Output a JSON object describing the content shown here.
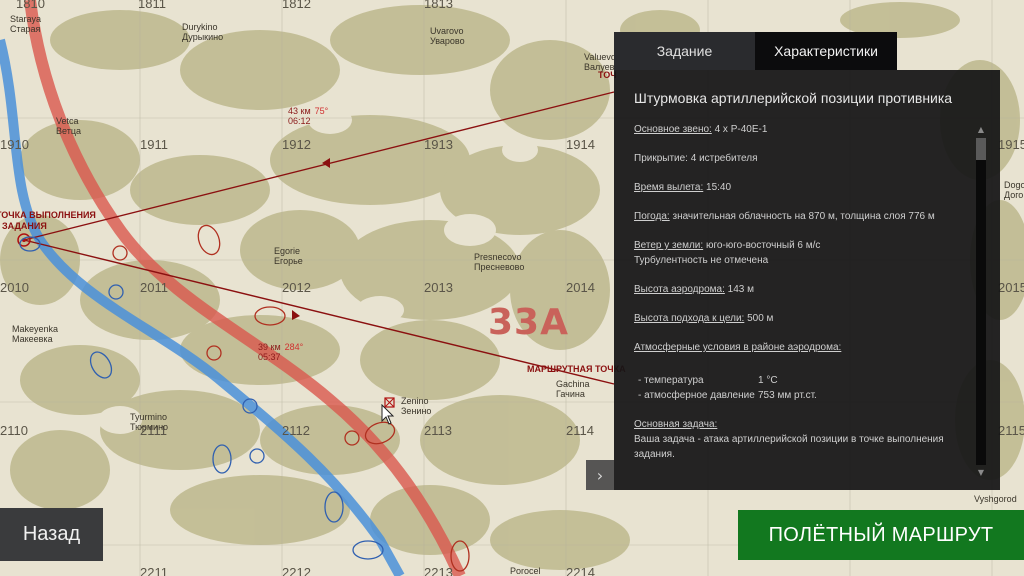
{
  "map": {
    "grid_numbers": [
      "1810",
      "1811",
      "1812",
      "1813",
      "1910",
      "1911",
      "1912",
      "1913",
      "1914",
      "2010",
      "2011",
      "2012",
      "2013",
      "2014",
      "2110",
      "2111",
      "2112",
      "2113",
      "2114",
      "2211",
      "2212",
      "2213",
      "2214",
      "1915",
      "2015",
      "2115"
    ],
    "places": [
      {
        "name_lat": "Staraya",
        "name_cyr": "Старая"
      },
      {
        "name_lat": "Durykino",
        "name_cyr": "Дурыкино"
      },
      {
        "name_lat": "Uvarovo",
        "name_cyr": "Уварово"
      },
      {
        "name_lat": "Valuevo",
        "name_cyr": "Валуево"
      },
      {
        "name_lat": "Vetca",
        "name_cyr": "Ветца"
      },
      {
        "name_lat": "Egorie",
        "name_cyr": "Егорье"
      },
      {
        "name_lat": "Presnecovo",
        "name_cyr": "Пресневово"
      },
      {
        "name_lat": "Makeyenka",
        "name_cyr": "Макеевка"
      },
      {
        "name_lat": "Zenino",
        "name_cyr": "Зенино"
      },
      {
        "name_lat": "Tyurmino",
        "name_cyr": "Тюрмино"
      },
      {
        "name_lat": "Gachina",
        "name_cyr": "Гачина"
      },
      {
        "name_lat": "Dogo",
        "name_cyr": "Дого"
      },
      {
        "name_lat": "Vyshgorod",
        "name_cyr": ""
      },
      {
        "name_lat": "Porocel",
        "name_cyr": ""
      }
    ],
    "zone_label": "33А",
    "target_label_line1": "ТОЧКА ВЫПОЛНЕНИЯ",
    "target_label_line2": "ЗАДАНИЯ",
    "route_waypoint_label": "МАРШРУТНАЯ ТОЧКА",
    "top_waypoint_label": "ТОЧ",
    "leg1": {
      "distance": "43 км",
      "time": "06:12",
      "heading": "75°"
    },
    "leg2": {
      "distance": "39 км",
      "time": "05:37",
      "heading": "284°"
    }
  },
  "tabs": [
    {
      "label": "Задание",
      "active": false
    },
    {
      "label": "Характеристики",
      "active": true
    }
  ],
  "briefing": {
    "title": "Штурмовка артиллерийской позиции противника",
    "main_flight_key": "Основное звено:",
    "main_flight_val": "4 x P-40E-1",
    "cover": "Прикрытие: 4 истребителя",
    "departure_key": "Время вылета:",
    "departure_val": "15:40",
    "weather_key": "Погода:",
    "weather_val": "значительная облачность на 870 м, толщина слоя 776 м",
    "wind_key": "Ветер у земли:",
    "wind_val": "юго-юго-восточный 6 м/с",
    "turbulence": "Турбулентность не отмечена",
    "airfield_alt_key": "Высота аэродрома:",
    "airfield_alt_val": "143 м",
    "approach_alt_key": "Высота подхода к цели:",
    "approach_alt_val": "500 м",
    "atmo_key": "Атмосферные условия в районе аэродрома:",
    "temp_key": "- температура",
    "temp_val": "1 °C",
    "pressure_key": "- атмосферное давление",
    "pressure_val": "753 мм рт.ст.",
    "main_task_key": "Основная задача:",
    "main_task_val": "Ваша задача - атака артиллерийской позиции в точке выполнения задания."
  },
  "buttons": {
    "back": "Назад",
    "flight_route": "ПОЛЁТНЫЙ МАРШРУТ",
    "collapse": "›"
  },
  "colors": {
    "front_line": "#d9584e",
    "river": "#4a90d9",
    "route": "#8b1010",
    "route_button": "#12781f"
  }
}
